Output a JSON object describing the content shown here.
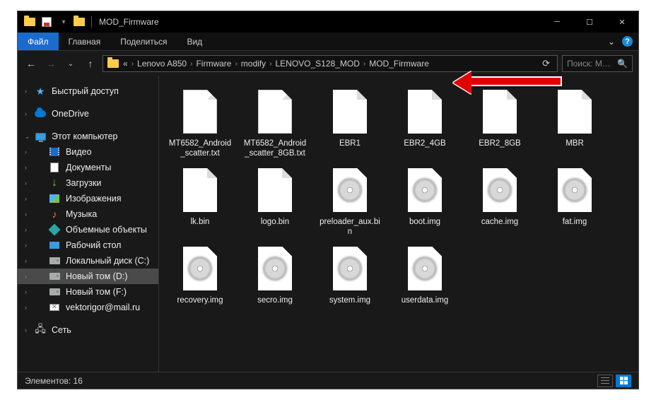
{
  "window": {
    "title": "MOD_Firmware"
  },
  "ribbon": {
    "file": "Файл",
    "tabs": [
      "Главная",
      "Поделиться",
      "Вид"
    ]
  },
  "breadcrumb": {
    "prefix": "«",
    "segments": [
      "Lenovo A850",
      "Firmware",
      "modify",
      "LENOVO_S128_MOD",
      "MOD_Firmware"
    ]
  },
  "search": {
    "placeholder": "Поиск: M…"
  },
  "sidebar": {
    "quick_access": "Быстрый доступ",
    "onedrive": "OneDrive",
    "this_pc": "Этот компьютер",
    "items": [
      {
        "label": "Видео",
        "icon": "film"
      },
      {
        "label": "Документы",
        "icon": "doc"
      },
      {
        "label": "Загрузки",
        "icon": "down"
      },
      {
        "label": "Изображения",
        "icon": "img"
      },
      {
        "label": "Музыка",
        "icon": "music"
      },
      {
        "label": "Объемные объекты",
        "icon": "cube"
      },
      {
        "label": "Рабочий стол",
        "icon": "desktop"
      },
      {
        "label": "Локальный диск (C:)",
        "icon": "drive"
      },
      {
        "label": "Новый том (D:)",
        "icon": "drive",
        "selected": true
      },
      {
        "label": "Новый том (F:)",
        "icon": "drive"
      },
      {
        "label": "vektorigor@mail.ru",
        "icon": "mail"
      }
    ],
    "network": "Сеть"
  },
  "files": [
    {
      "name": "MT6582_Android_scatter.txt",
      "type": "doc"
    },
    {
      "name": "MT6582_Android_scatter_8GB.txt",
      "type": "doc"
    },
    {
      "name": "EBR1",
      "type": "blank"
    },
    {
      "name": "EBR2_4GB",
      "type": "blank"
    },
    {
      "name": "EBR2_8GB",
      "type": "blank"
    },
    {
      "name": "MBR",
      "type": "blank"
    },
    {
      "name": "lk.bin",
      "type": "blank"
    },
    {
      "name": "logo.bin",
      "type": "blank"
    },
    {
      "name": "preloader_aux.bin",
      "type": "disc"
    },
    {
      "name": "boot.img",
      "type": "disc"
    },
    {
      "name": "cache.img",
      "type": "disc"
    },
    {
      "name": "fat.img",
      "type": "disc"
    },
    {
      "name": "recovery.img",
      "type": "disc"
    },
    {
      "name": "secro.img",
      "type": "disc"
    },
    {
      "name": "system.img",
      "type": "disc"
    },
    {
      "name": "userdata.img",
      "type": "disc"
    }
  ],
  "status": {
    "count_label": "Элементов: 16"
  }
}
